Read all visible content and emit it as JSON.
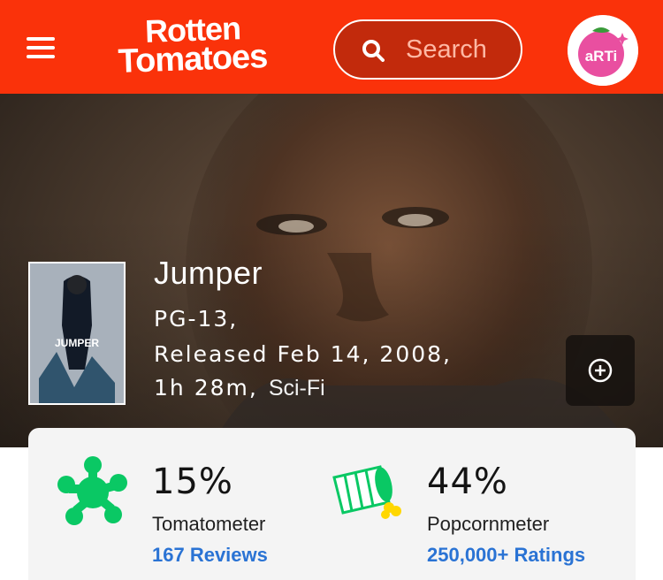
{
  "header": {
    "logo_line1": "Rotten",
    "logo_line2": "Tomatoes",
    "search_placeholder": "Search",
    "avatar_text": "aRTi",
    "brand_color": "#fa320a"
  },
  "movie": {
    "title": "Jumper",
    "rating": "PG-13,",
    "released": "Released Feb 14, 2008,",
    "runtime": "1h 28m,",
    "genre": "Sci-Fi",
    "poster_title": "JUMPER"
  },
  "scores": {
    "tomatometer": {
      "value": "15%",
      "label": "Tomatometer",
      "link": "167 Reviews"
    },
    "popcornmeter": {
      "value": "44%",
      "label": "Popcornmeter",
      "link": "250,000+ Ratings"
    }
  },
  "icons": {
    "menu": "hamburger-icon",
    "search": "search-icon",
    "add": "plus-circle-icon",
    "tomatometer": "green-splat-icon",
    "popcornmeter": "tipped-popcorn-bucket-icon"
  }
}
